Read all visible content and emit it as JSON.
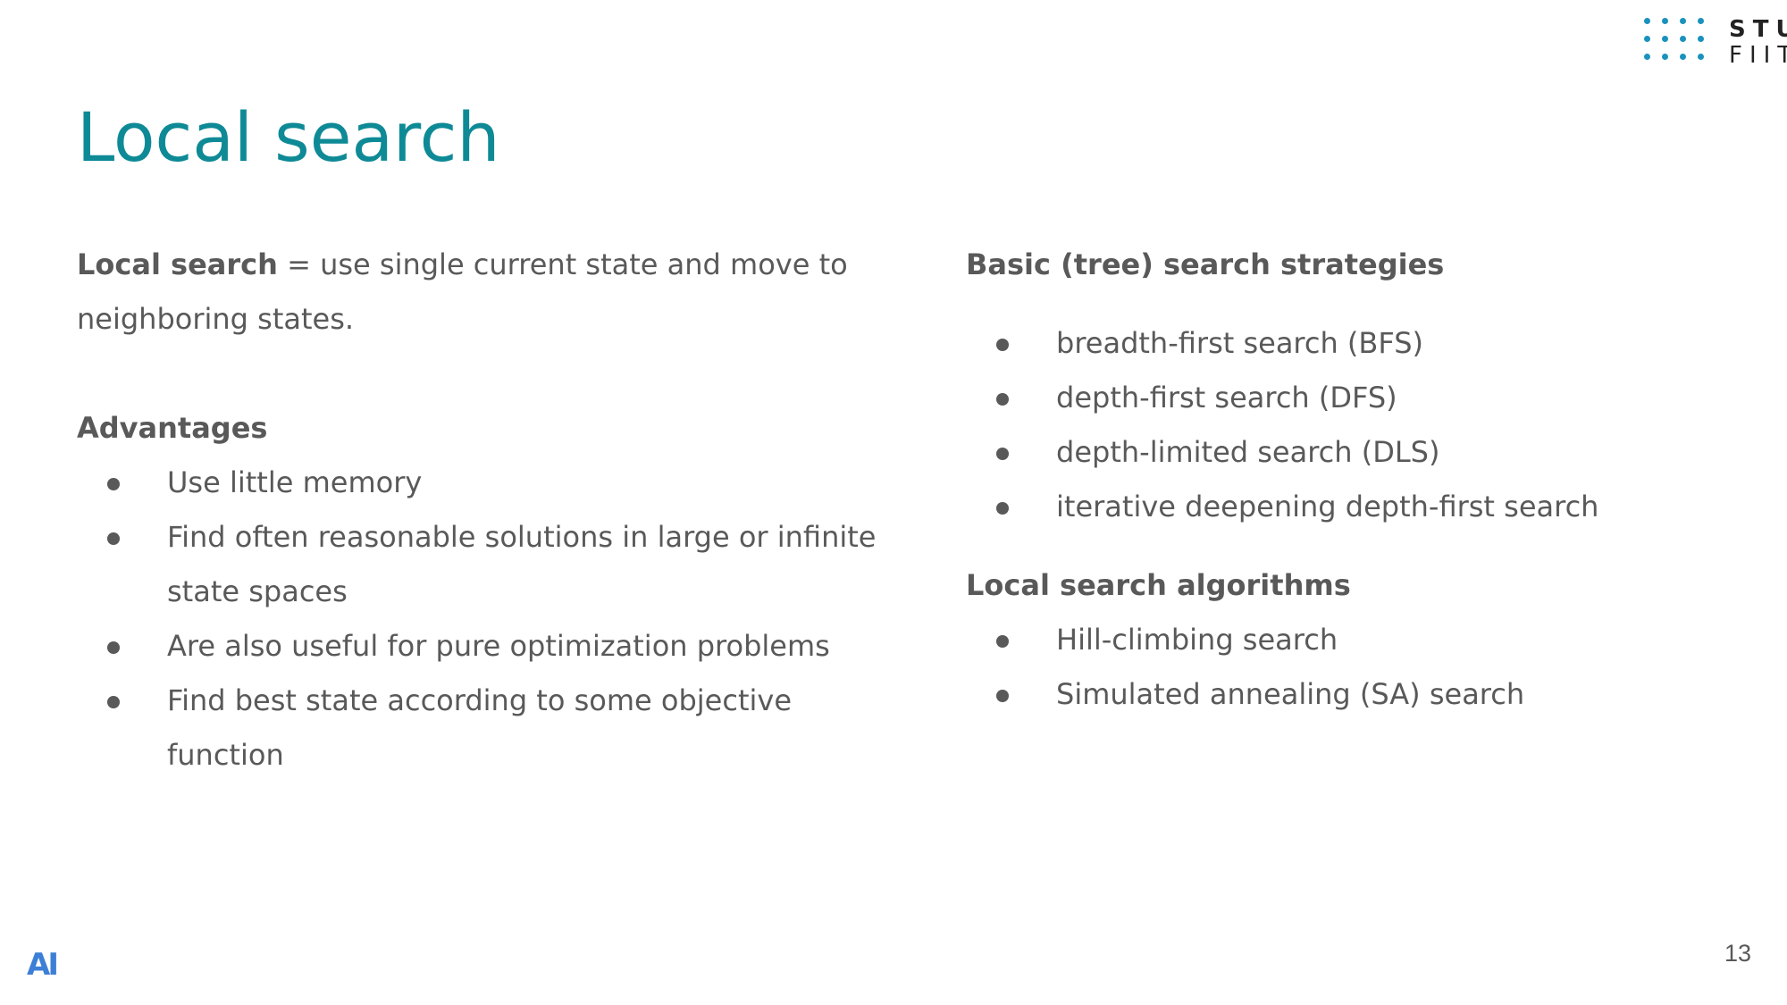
{
  "slide": {
    "title": "Local search",
    "page_number": "13"
  },
  "logo": {
    "line1": "STU",
    "line2": "FIIT",
    "dot_color": "#1a92bd"
  },
  "footer_logo": {
    "text": "AI",
    "color": "#3d7fd6"
  },
  "left": {
    "intro_term": "Local search",
    "intro_rest": " = use single current state and move to neighboring states.",
    "advantages_heading": "Advantages",
    "advantages": [
      "Use little memory",
      "Find often reasonable solutions in large or infinite state spaces",
      "Are also useful for pure optimization problems",
      "Find best state according to some objective function"
    ]
  },
  "right": {
    "basic_heading": "Basic (tree) search strategies",
    "basic_items": [
      "breadth-first search (BFS)",
      "depth-first search (DFS)",
      "depth-limited search (DLS)",
      "iterative deepening depth-first search"
    ],
    "algorithms_heading": "Local search algorithms",
    "algorithm_items": [
      "Hill-climbing search",
      "Simulated annealing (SA) search"
    ]
  },
  "colors": {
    "title": "#0e8a96",
    "body_text": "#595959"
  }
}
